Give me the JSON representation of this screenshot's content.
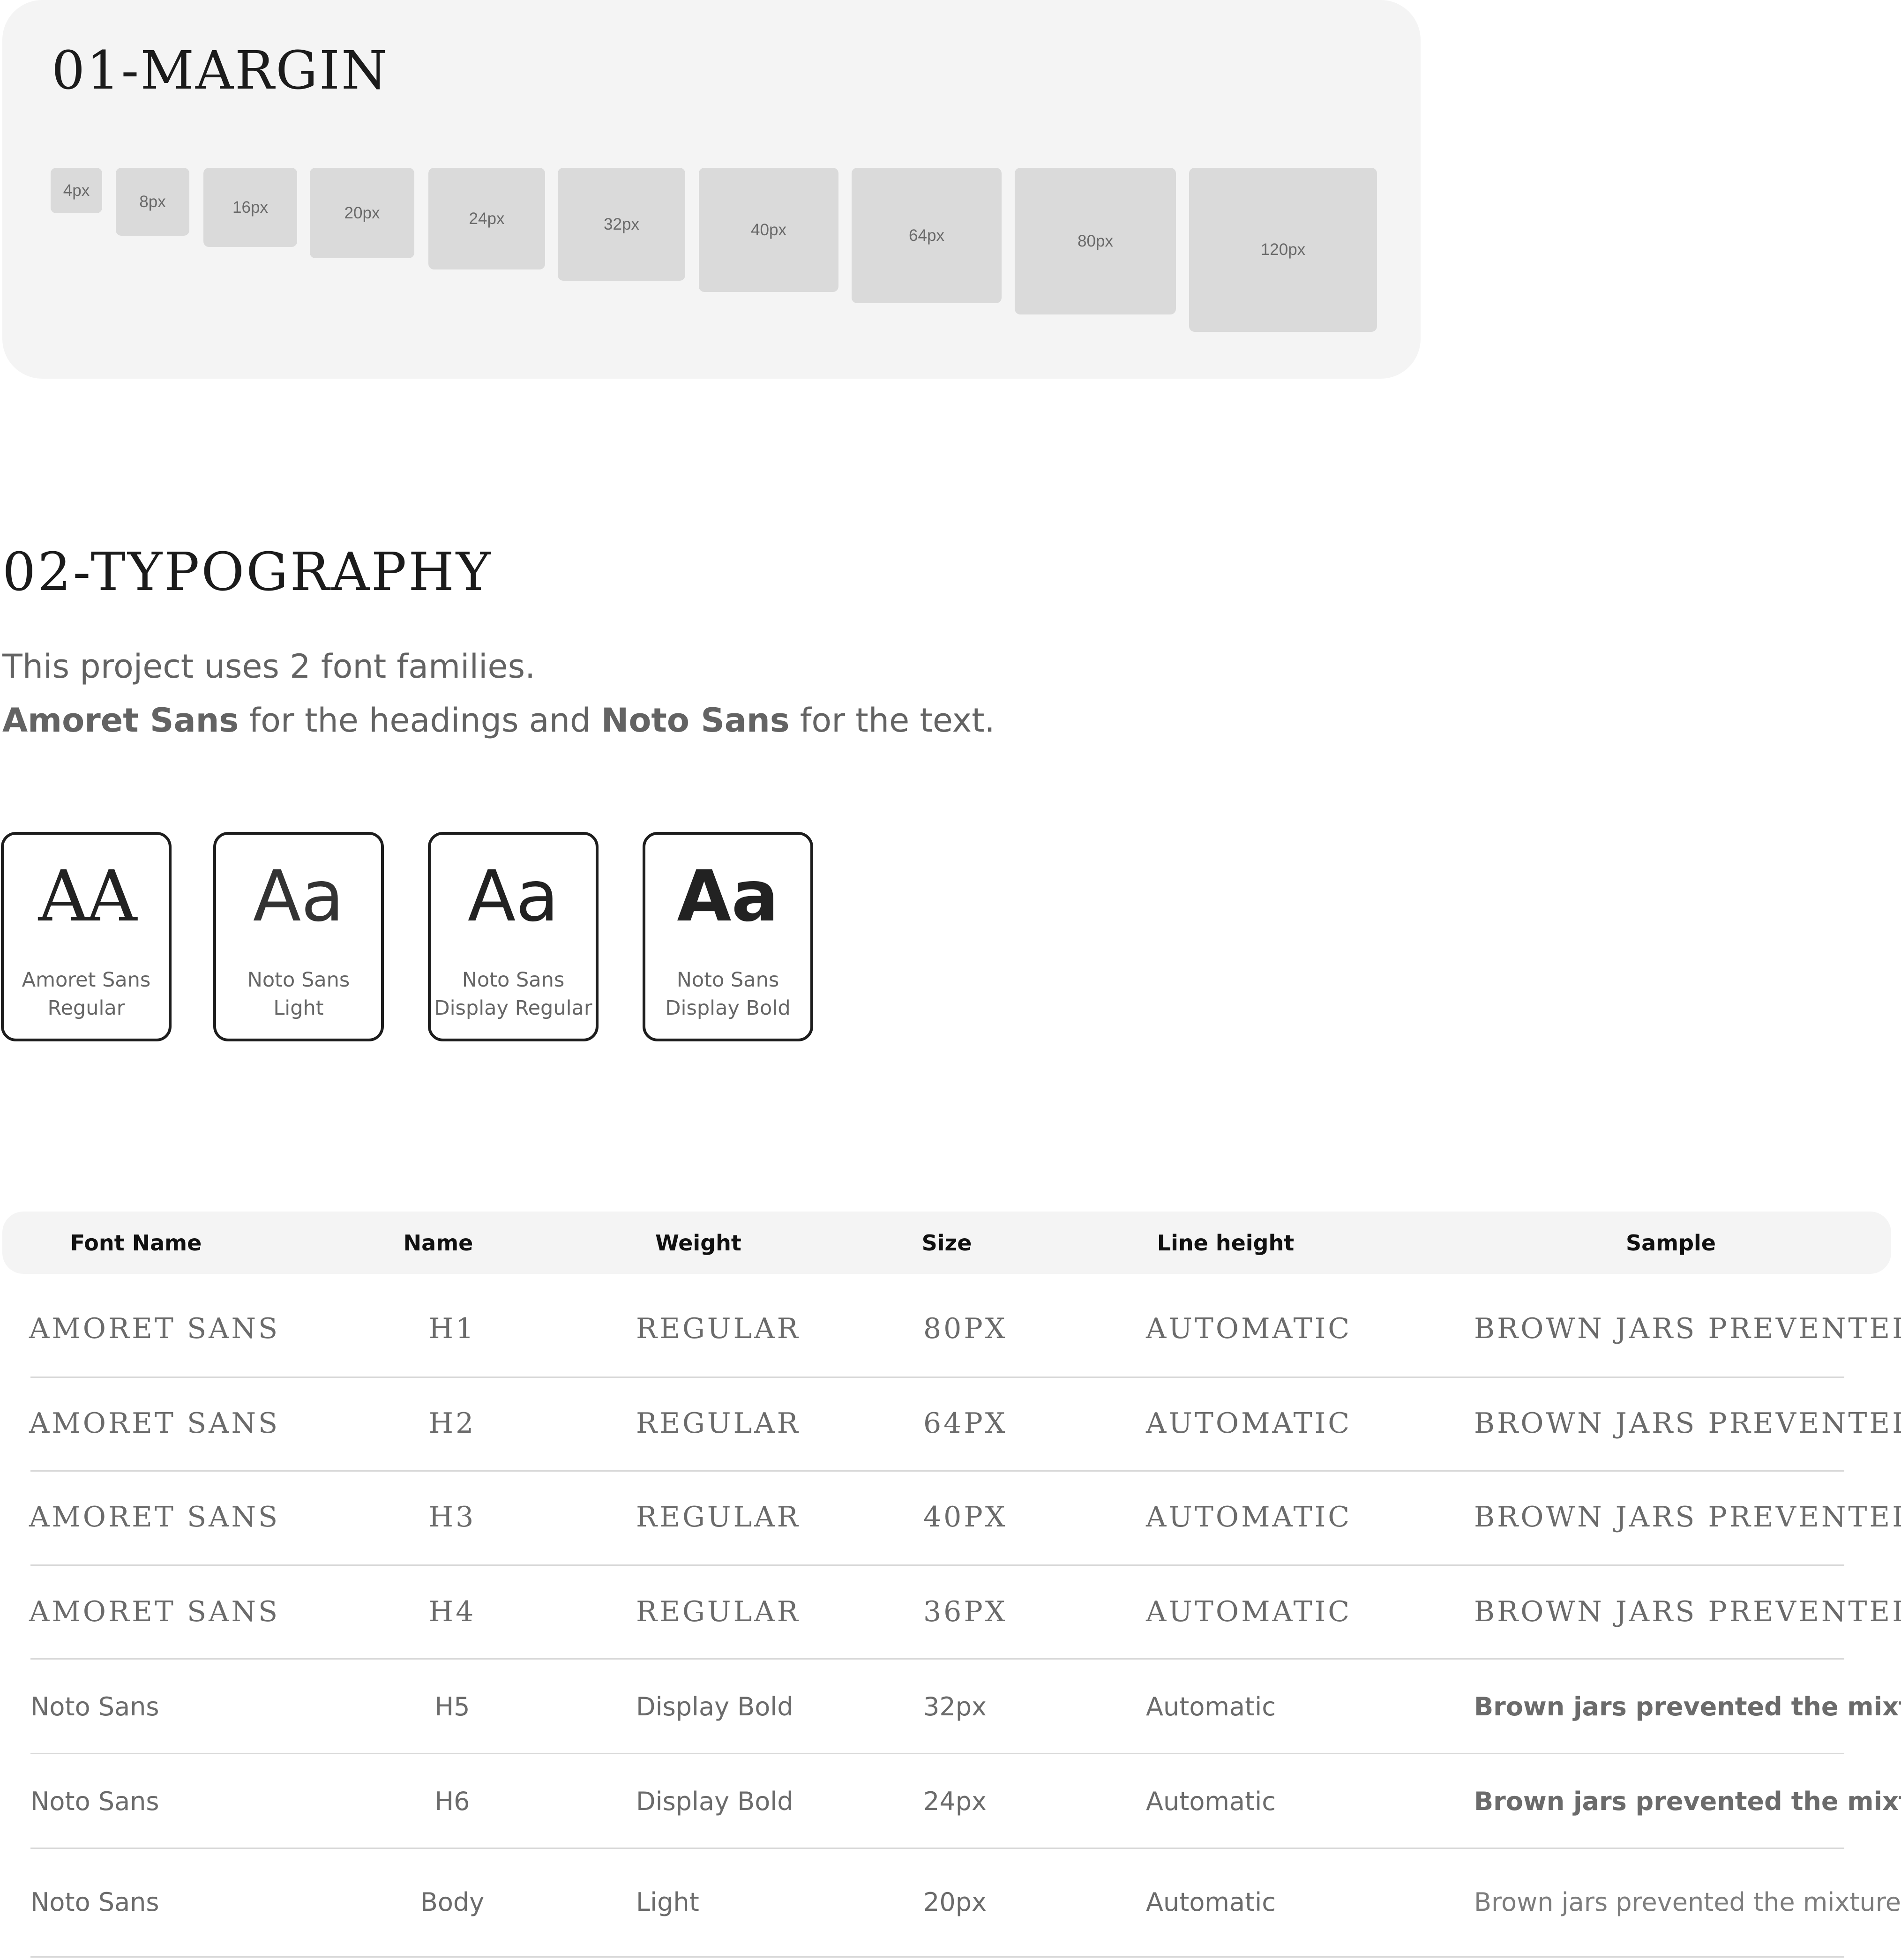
{
  "margin": {
    "title": "01-MARGIN",
    "swatches": [
      {
        "label": "4px",
        "value": 4
      },
      {
        "label": "8px",
        "value": 8
      },
      {
        "label": "16px",
        "value": 16
      },
      {
        "label": "20px",
        "value": 20
      },
      {
        "label": "24px",
        "value": 24
      },
      {
        "label": "32px",
        "value": 32
      },
      {
        "label": "40px",
        "value": 40
      },
      {
        "label": "64px",
        "value": 64
      },
      {
        "label": "80px",
        "value": 80
      },
      {
        "label": "120px",
        "value": 120
      }
    ]
  },
  "typography": {
    "title": "02-TYPOGRAPHY",
    "intro_line1": "This project uses 2 font families.",
    "intro_font1": "Amoret Sans",
    "intro_mid": " for the headings and ",
    "intro_font2": "Noto Sans",
    "intro_end": " for the text.",
    "cards": [
      {
        "glyph": "AA",
        "label_line1": "Amoret Sans",
        "label_line2": "Regular"
      },
      {
        "glyph": "Aa",
        "label_line1": "Noto Sans",
        "label_line2": "Light"
      },
      {
        "glyph": "Aa",
        "label_line1": "Noto Sans",
        "label_line2": "Display Regular"
      },
      {
        "glyph": "Aa",
        "label_line1": "Noto Sans",
        "label_line2": "Display Bold"
      }
    ]
  },
  "table": {
    "headers": [
      "Font Name",
      "Name",
      "Weight",
      "Size",
      "Line height",
      "Sample"
    ],
    "rows": [
      {
        "font": "AMORET SANS",
        "name": "H1",
        "weight": "REGULAR",
        "size": "80PX",
        "line_height": "AUTOMATIC",
        "sample": "BROWN JARS PREVENTED"
      },
      {
        "font": "AMORET SANS",
        "name": "H2",
        "weight": "REGULAR",
        "size": "64PX",
        "line_height": "AUTOMATIC",
        "sample": "BROWN JARS PREVENTED"
      },
      {
        "font": "AMORET SANS",
        "name": "H3",
        "weight": "REGULAR",
        "size": "40PX",
        "line_height": "AUTOMATIC",
        "sample": "BROWN JARS PREVENTED"
      },
      {
        "font": "AMORET SANS",
        "name": "H4",
        "weight": "REGULAR",
        "size": "36PX",
        "line_height": "AUTOMATIC",
        "sample": "BROWN JARS PREVENTED"
      },
      {
        "font": "Noto Sans",
        "name": "H5",
        "weight": "Display Bold",
        "size": "32px",
        "line_height": "Automatic",
        "sample": "Brown jars prevented the mixture"
      },
      {
        "font": "Noto Sans",
        "name": "H6",
        "weight": "Display Bold",
        "size": "24px",
        "line_height": "Automatic",
        "sample": "Brown jars prevented the mixture"
      },
      {
        "font": "Noto Sans",
        "name": "Body",
        "weight": "Light",
        "size": "20px",
        "line_height": "Automatic",
        "sample": "Brown jars prevented the mixture"
      }
    ]
  }
}
